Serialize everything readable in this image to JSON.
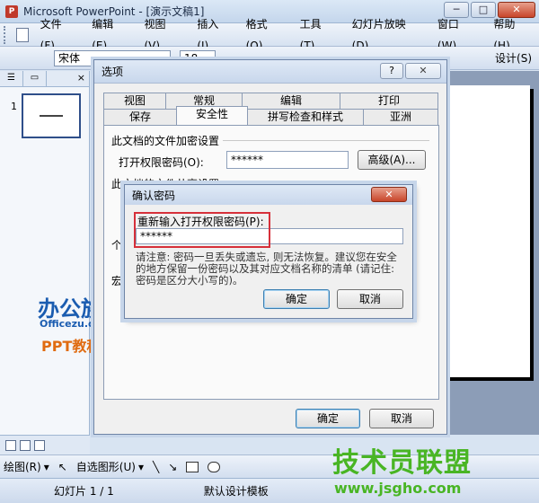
{
  "window": {
    "title": "Microsoft PowerPoint - [演示文稿1]",
    "controls": [
      "─",
      "□",
      "✕"
    ]
  },
  "menubar": {
    "items": [
      "文件(F)",
      "编辑(E)",
      "视图(V)",
      "插入(I)",
      "格式(O)",
      "工具(T)",
      "幻灯片放映(D)",
      "窗口(W)",
      "帮助(H)"
    ]
  },
  "toolbar": {
    "font": "宋体",
    "size": "18",
    "design_label": "设计(S)"
  },
  "left_pane": {
    "slide_number": "1",
    "close": "×"
  },
  "options_dialog": {
    "title": "选项",
    "help": "?",
    "close": "✕",
    "tabs_row1": [
      "视图",
      "常规",
      "编辑",
      "打印"
    ],
    "tabs_row2": [
      "保存",
      "安全性",
      "拼写检查和样式",
      "亚洲"
    ],
    "active_tab": "安全性",
    "encrypt_section": "此文档的文件加密设置",
    "open_password_label": "打开权限密码(O):",
    "open_password_value": "******",
    "advanced_button": "高级(A)...",
    "share_section": "此文档的文件共享设置",
    "partial_label_1": "个",
    "partial_label_2": "宏",
    "ok": "确定",
    "cancel": "取消"
  },
  "confirm_dialog": {
    "title": "确认密码",
    "close": "✕",
    "prompt": "重新输入打开权限密码(P):",
    "password_value": "******",
    "warning": "请注意: 密码一旦丢失或遗忘, 则无法恢复。建议您在安全的地方保留一份密码以及其对应文档名称的清单 (请记住: 密码是区分大小写的)。",
    "ok": "确定",
    "cancel": "取消"
  },
  "drawbar": {
    "draw_label": "绘图(R)",
    "autoshapes_label": "自选图形(U)"
  },
  "status": {
    "slide": "幻灯片 1 / 1",
    "template": "默认设计模板"
  },
  "watermarks": {
    "logo": "办公族",
    "logo_site": "Officezu.com",
    "logo_sub": "PPT教程",
    "right_brand": "技术员联盟",
    "right_url": "www.jsgho.com"
  },
  "colors": {
    "highlight_box": "#d6303a",
    "title_gradient": "#c8d7ec",
    "close_red": "#c8452a"
  }
}
